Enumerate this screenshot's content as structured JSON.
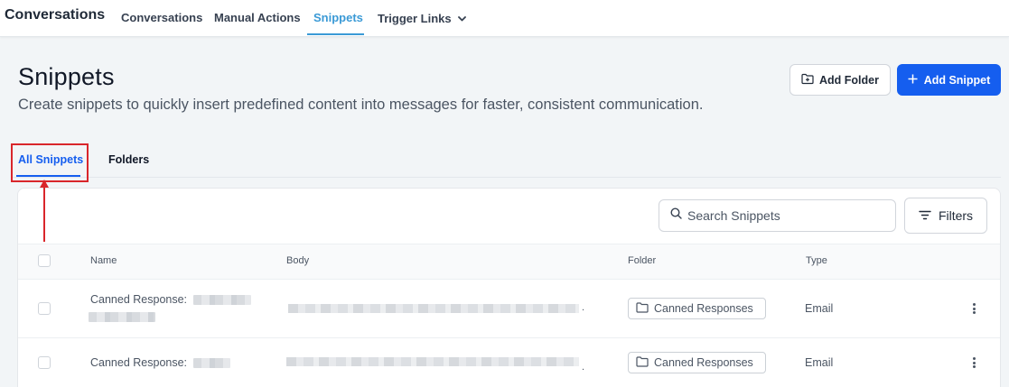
{
  "app_title": "Conversations",
  "nav": {
    "items": [
      "Conversations",
      "Manual Actions",
      "Snippets",
      "Trigger Links"
    ],
    "active": "Snippets"
  },
  "header": {
    "title": "Snippets",
    "subtitle": "Create snippets to quickly insert predefined content into messages for faster, consistent communication.",
    "add_folder_label": "Add Folder",
    "add_snippet_label": "Add Snippet"
  },
  "tabs": {
    "all": "All Snippets",
    "folders": "Folders",
    "active": "All Snippets"
  },
  "toolbar": {
    "search_placeholder": "Search Snippets",
    "filters_label": "Filters"
  },
  "table": {
    "columns": [
      "Name",
      "Body",
      "Folder",
      "Type"
    ],
    "rows": [
      {
        "name": "Canned Response:",
        "folder": "Canned Responses",
        "type": "Email"
      },
      {
        "name": "Canned Response:",
        "folder": "Canned Responses",
        "type": "Email"
      }
    ]
  },
  "colors": {
    "accent": "#155eef",
    "nav_active": "#3b9ad6",
    "annotation": "#d9262b"
  }
}
